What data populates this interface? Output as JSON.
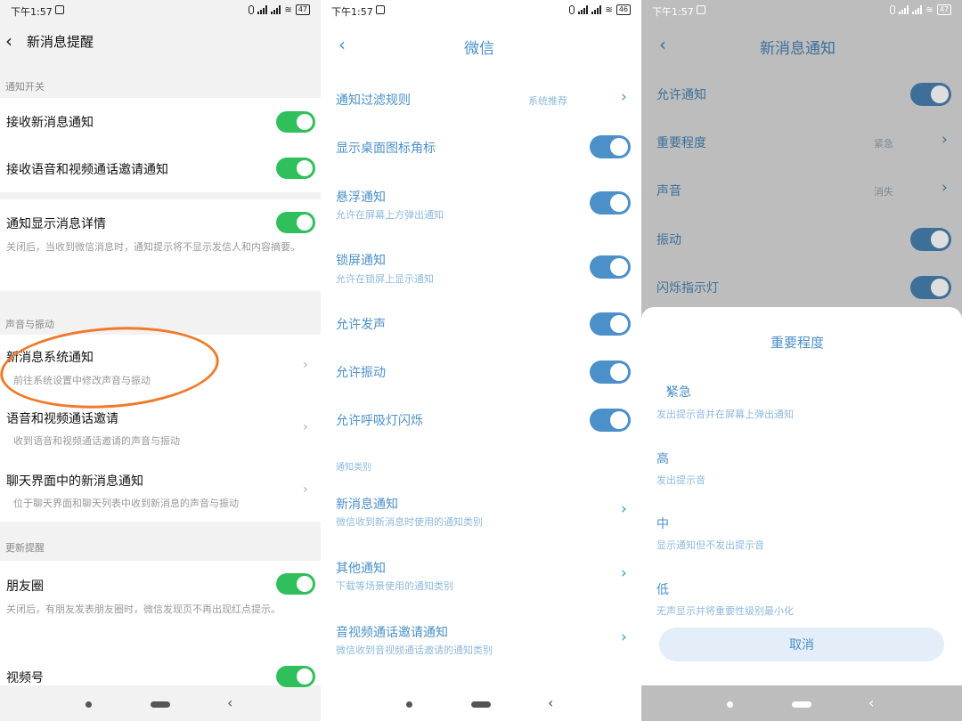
{
  "panel1": {
    "status": {
      "time": "下午1:57",
      "battery": "47"
    },
    "title": "新消息提醒",
    "section_notify": "通知开关",
    "receive_new": "接收新消息通知",
    "receive_call": "接收语音和视频通话邀请通知",
    "show_detail": "通知显示消息详情",
    "show_detail_sub": "关闭后，当收到微信消息时，通知提示将不显示发信人和内容摘要。",
    "section_sound": "声音与振动",
    "sys_notify": "新消息系统通知",
    "sys_notify_sub": "前往系统设置中修改声音与振动",
    "call_invite": "语音和视频通话邀请",
    "call_invite_sub": "收到语音和视频通话邀请的声音与振动",
    "chat_notify": "聊天界面中的新消息通知",
    "chat_notify_sub": "位于聊天界面和聊天列表中收到新消息的声音与振动",
    "section_update": "更新提醒",
    "moments": "朋友圈",
    "moments_sub": "关闭后，有朋友发表朋友圈时，微信发现页不再出现红点提示。",
    "channels": "视频号"
  },
  "panel2": {
    "status": {
      "time": "下午1:57",
      "battery": "46"
    },
    "title": "微信",
    "filter_rule": "通知过滤规则",
    "filter_value": "系统推荐",
    "badge": "显示桌面图标角标",
    "float": "悬浮通知",
    "float_sub": "允许在屏幕上方弹出通知",
    "lock": "锁屏通知",
    "lock_sub": "允许在锁屏上显示通知",
    "sound": "允许发声",
    "vibrate": "允许振动",
    "breath": "允许呼吸灯闪烁",
    "category": "通知类别",
    "new_msg": "新消息通知",
    "new_msg_sub": "微信收到新消息时使用的通知类别",
    "other": "其他通知",
    "other_sub": "下载等场景使用的通知类别",
    "av_call": "音视频通话邀请通知",
    "av_call_sub": "微信收到音视频通话邀请的通知类别"
  },
  "panel3": {
    "status": {
      "time": "下午1:57",
      "battery": "47"
    },
    "title": "新消息通知",
    "allow": "允许通知",
    "importance": "重要程度",
    "importance_value": "紧急",
    "sound": "声音",
    "sound_value": "消失",
    "vibrate": "振动",
    "led": "闪烁指示灯",
    "sheet_title": "重要程度",
    "opt_urgent": "紧急",
    "opt_urgent_sub": "发出提示音并在屏幕上弹出通知",
    "opt_high": "高",
    "opt_high_sub": "发出提示音",
    "opt_mid": "中",
    "opt_mid_sub": "显示通知但不发出提示音",
    "opt_low": "低",
    "opt_low_sub": "无声显示并将重要性级别最小化",
    "cancel": "取消"
  },
  "colors": {
    "green_toggle": "#2fbf5b",
    "blue_accent": "#4b90c9",
    "highlight_circle": "#f07a2a"
  }
}
